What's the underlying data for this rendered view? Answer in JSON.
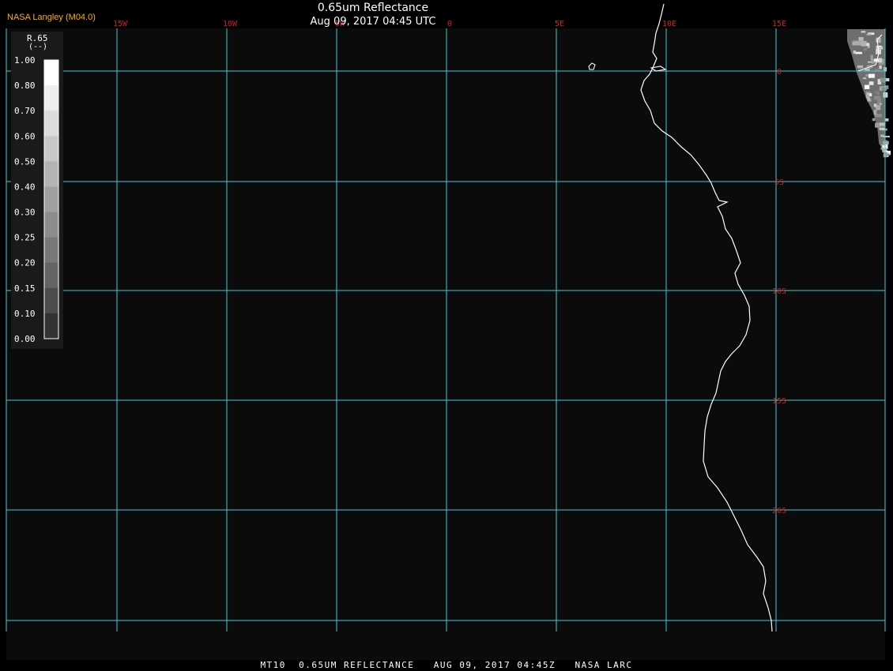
{
  "header": {
    "title": "0.65um Reflectance",
    "subtitle": "Aug 09, 2017 04:45 UTC",
    "agency": "NASA Langley (M04.0)"
  },
  "footer": {
    "text": "MT10  0.65UM REFLECTANCE   AUG 09, 2017 04:45Z   NASA LARC"
  },
  "legend": {
    "variable": "R.65",
    "units": "(--)",
    "ticks": [
      "1.00",
      "0.80",
      "0.70",
      "0.60",
      "0.50",
      "0.40",
      "0.30",
      "0.25",
      "0.20",
      "0.15",
      "0.10",
      "0.00"
    ],
    "bin_colors": [
      "#ffffff",
      "#eeeeee",
      "#dcdcdc",
      "#c8c8c8",
      "#b4b4b4",
      "#a0a0a0",
      "#8c8c8c",
      "#787878",
      "#646464",
      "#4c4c4c",
      "#333333",
      "#1a1a1a"
    ]
  },
  "map": {
    "graticule_color": "#40c8d8",
    "label_color": "#cc2222",
    "coast_color": "#ffffff",
    "lon_labels": [
      "15W",
      "10W",
      "5W",
      "0",
      "5E",
      "10E",
      "15E"
    ],
    "lat_labels": [
      "0",
      "5S",
      "10S",
      "15S",
      "20S"
    ]
  }
}
